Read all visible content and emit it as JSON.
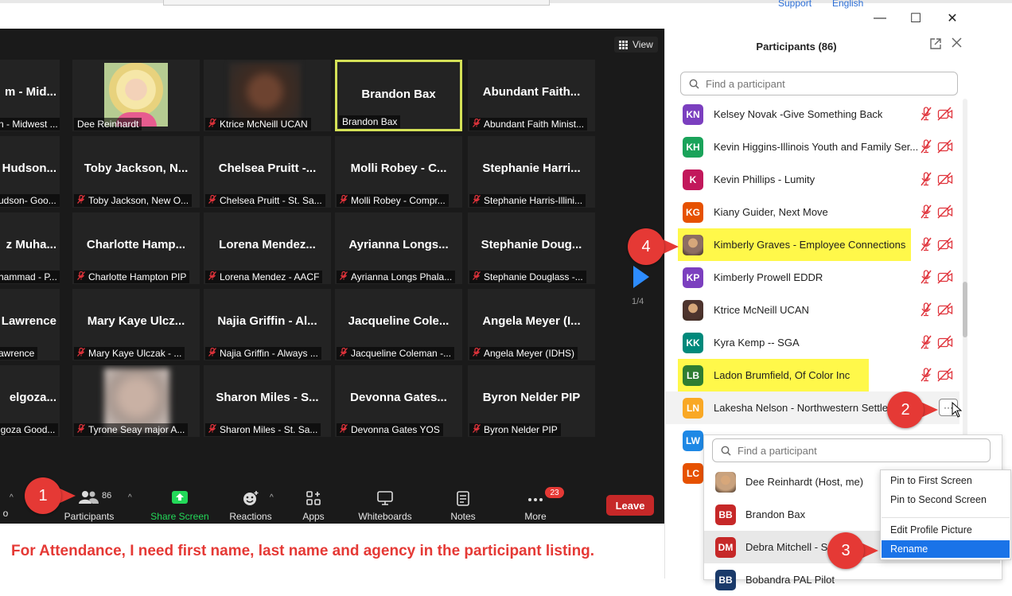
{
  "top": {
    "support_link": "Support",
    "language_link": "English",
    "minimize_glyph": "—",
    "maximize_glyph": "☐",
    "close_glyph": "✕"
  },
  "video": {
    "view_label": "View",
    "page_indicator": "1/4",
    "tiles": [
      {
        "name": "m - Mid...",
        "label": "n - Midwest ...",
        "muted": false,
        "photo": ""
      },
      {
        "name": "",
        "label": "Dee Reinhardt",
        "muted": false,
        "photo": "dee"
      },
      {
        "name": "",
        "label": "Ktrice McNeill UCAN",
        "muted": true,
        "photo": "ktrice"
      },
      {
        "name": "Brandon Bax",
        "label": "Brandon Bax",
        "muted": false,
        "photo": "",
        "active": true
      },
      {
        "name": "Abundant  Faith...",
        "label": "Abundant Faith Minist...",
        "muted": true,
        "photo": ""
      },
      {
        "name": "Hudson...",
        "label": "udson- Goo...",
        "muted": false,
        "photo": ""
      },
      {
        "name": "Toby  Jackson,  N...",
        "label": "Toby Jackson, New O...",
        "muted": true,
        "photo": ""
      },
      {
        "name": "Chelsea  Pruitt  -...",
        "label": "Chelsea Pruitt - St. Sa...",
        "muted": true,
        "photo": ""
      },
      {
        "name": "Molli  Robey  -  C...",
        "label": "Molli Robey - Compr...",
        "muted": true,
        "photo": ""
      },
      {
        "name": "Stephanie  Harri...",
        "label": "Stephanie Harris-Illini...",
        "muted": true,
        "photo": ""
      },
      {
        "name": "z  Muha...",
        "label": "hammad - P...",
        "muted": false,
        "photo": ""
      },
      {
        "name": "Charlotte  Hamp...",
        "label": "Charlotte Hampton PIP",
        "muted": true,
        "photo": ""
      },
      {
        "name": "Lorena  Mendez...",
        "label": "Lorena Mendez - AACF",
        "muted": true,
        "photo": ""
      },
      {
        "name": "Ayrianna  Longs...",
        "label": "Ayrianna Longs Phala...",
        "muted": true,
        "photo": ""
      },
      {
        "name": "Stephanie  Doug...",
        "label": "Stephanie Douglass -...",
        "muted": true,
        "photo": ""
      },
      {
        "name": "Lawrence",
        "label": "awrence",
        "muted": false,
        "photo": ""
      },
      {
        "name": "Mary  Kaye  Ulcz...",
        "label": "Mary Kaye Ulczak - ...",
        "muted": true,
        "photo": ""
      },
      {
        "name": "Najia  Griffin  -  Al...",
        "label": "Najia Griffin - Always ...",
        "muted": true,
        "photo": ""
      },
      {
        "name": "Jacqueline  Cole...",
        "label": "Jacqueline Coleman -...",
        "muted": true,
        "photo": ""
      },
      {
        "name": "Angela  Meyer  (I...",
        "label": "Angela Meyer (IDHS)",
        "muted": true,
        "photo": ""
      },
      {
        "name": "elgoza...",
        "label": "lgoza Good...",
        "muted": false,
        "photo": ""
      },
      {
        "name": "",
        "label": "Tyrone Seay major A...",
        "muted": true,
        "photo": "tyrone"
      },
      {
        "name": "Sharon  Miles  -  S...",
        "label": "Sharon Miles - St. Sa...",
        "muted": true,
        "photo": ""
      },
      {
        "name": "Devonna  Gates...",
        "label": "Devonna Gates YOS",
        "muted": true,
        "photo": ""
      },
      {
        "name": "Byron  Nelder  PIP",
        "label": "Byron Nelder PIP",
        "muted": true,
        "photo": ""
      }
    ]
  },
  "toolbar": {
    "partial_label": "o",
    "participants_label": "Participants",
    "participants_count": "86",
    "share_label": "Share Screen",
    "reactions_label": "Reactions",
    "apps_label": "Apps",
    "whiteboards_label": "Whiteboards",
    "notes_label": "Notes",
    "more_label": "More",
    "more_badge": "23",
    "leave_label": "Leave"
  },
  "caption": "For Attendance, I need first name, last name and agency in the participant listing.",
  "panel": {
    "title": "Participants (86)",
    "search_placeholder": "Find a participant",
    "participants": [
      {
        "initials": "KN",
        "name": "Kelsey Novak -Give Something Back",
        "color": "#7b3fbf",
        "photo": false,
        "highlight": false
      },
      {
        "initials": "KH",
        "name": "Kevin Higgins-Illinois Youth and Family Ser...",
        "color": "#1aa35a",
        "photo": false,
        "highlight": false
      },
      {
        "initials": "K",
        "name": "Kevin Phillips - Lumity",
        "color": "#c2185b",
        "photo": false,
        "highlight": false
      },
      {
        "initials": "KG",
        "name": "Kiany Guider, Next Move",
        "color": "#e65100",
        "photo": false,
        "highlight": false
      },
      {
        "initials": "",
        "name": "Kimberly Graves - Employee Connections",
        "color": "#8d6e63",
        "photo": true,
        "highlight": true
      },
      {
        "initials": "KP",
        "name": "Kimberly Prowell EDDR",
        "color": "#7b3fbf",
        "photo": false,
        "highlight": false
      },
      {
        "initials": "",
        "name": "Ktrice McNeill UCAN",
        "color": "#4e342e",
        "photo": true,
        "highlight": false
      },
      {
        "initials": "KK",
        "name": "Kyra Kemp -- SGA",
        "color": "#00897b",
        "photo": false,
        "highlight": false
      },
      {
        "initials": "LB",
        "name": "Ladon Brumfield, Of Color Inc",
        "color": "#2e7d32",
        "photo": false,
        "highlight": true
      },
      {
        "initials": "LN",
        "name": "Lakesha Nelson - Northwestern Settle",
        "color": "#f9a825",
        "photo": false,
        "highlight": false,
        "hover": true
      },
      {
        "initials": "LW",
        "name": "",
        "color": "#1e88e5",
        "photo": false,
        "highlight": false
      },
      {
        "initials": "LC",
        "name": "",
        "color": "#e65100",
        "photo": false,
        "highlight": false
      }
    ],
    "more_button": "···"
  },
  "overlay2": {
    "search_placeholder": "Find a participant",
    "participants": [
      {
        "initials": "",
        "name": "Dee Reinhardt (Host, me)",
        "color": "#c9a27e",
        "photo": true
      },
      {
        "initials": "BB",
        "name": "Brandon Bax",
        "color": "#c62828",
        "photo": false
      },
      {
        "initials": "DM",
        "name": "Debra Mitchell - S",
        "color": "#c62828",
        "photo": false
      },
      {
        "initials": "BB",
        "name": "Bobandra PAL Pilot",
        "color": "#1a3a6a",
        "photo": false
      }
    ]
  },
  "context_menu": {
    "items": [
      "Pin to First Screen",
      "Pin to Second Screen",
      "Edit Profile Picture",
      "Rename"
    ],
    "selected": "Rename"
  },
  "steps": [
    "1",
    "2",
    "3",
    "4"
  ],
  "colors": {
    "zoom_blue": "#2d8cff",
    "step_red": "#e53935",
    "highlight_yellow": "#fff84a",
    "active_speaker": "#d4e157",
    "share_green": "#23d959"
  }
}
